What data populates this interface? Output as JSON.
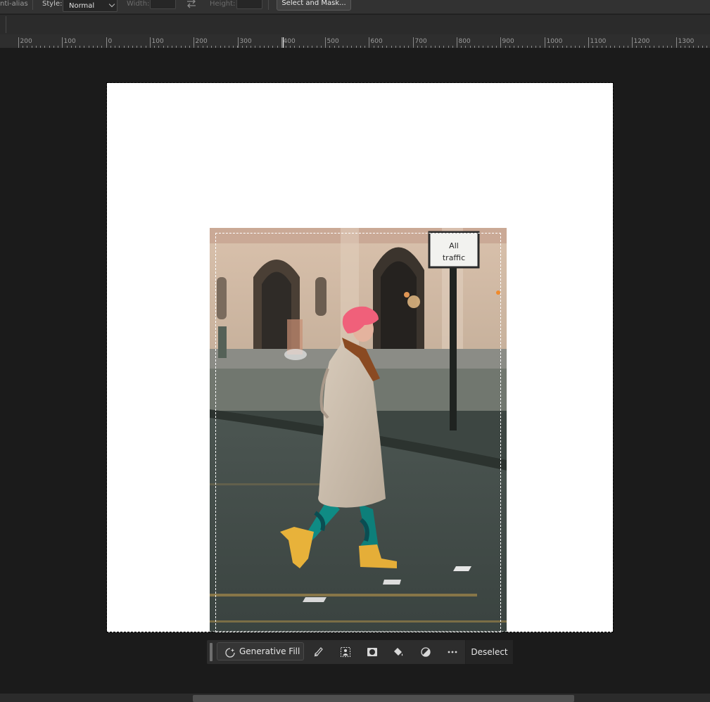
{
  "options_bar": {
    "anti_alias_label": "nti-alias",
    "style_label": "Style:",
    "style_value": "Normal",
    "width_label": "Width:",
    "height_label": "Height:",
    "select_and_mask_label": "Select and Mask..."
  },
  "ruler": {
    "ticks": [
      "200",
      "100",
      "0",
      "100",
      "200",
      "300",
      "400",
      "500",
      "600",
      "700",
      "800",
      "900",
      "1000",
      "1100",
      "1200",
      "1300"
    ]
  },
  "canvas": {
    "background_color": "#ffffff",
    "workspace_color": "#1b1b1b"
  },
  "photo": {
    "sign_text_line1": "All",
    "sign_text_line2": "traffic"
  },
  "contextual_task_bar": {
    "generative_fill_label": "Generative Fill",
    "icons": [
      "brush-icon",
      "select-subject-icon",
      "mask-icon",
      "fill-bucket-icon",
      "adjustment-icon",
      "more-icon"
    ],
    "deselect_label": "Deselect"
  }
}
